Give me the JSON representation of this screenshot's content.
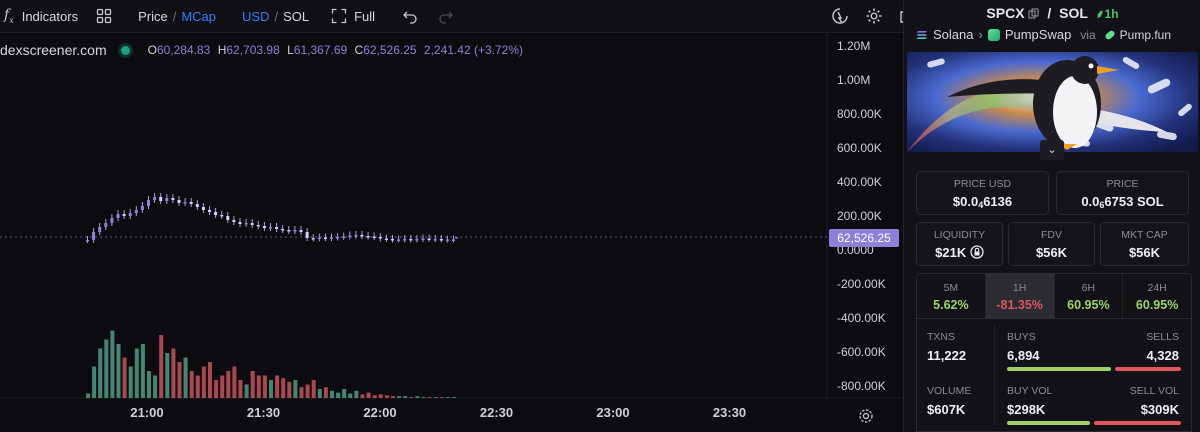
{
  "toolbar": {
    "indicators": "Indicators",
    "price": "Price",
    "mcap": "MCap",
    "usd": "USD",
    "sol": "SOL",
    "full": "Full"
  },
  "legend": {
    "source": "dexscreener.com",
    "o_key": "O",
    "o_val": "60,284.83",
    "h_key": "H",
    "h_val": "62,703.98",
    "l_key": "L",
    "l_val": "61,367.69",
    "c_key": "C",
    "c_val": "62,526.25",
    "change": "2,241.42 (+3.72%)"
  },
  "current_price_label": "62,526.25",
  "colors": {
    "up": "#4c9e83",
    "down": "#c8545a",
    "line": "#a99ee6",
    "accent": "#2f80ff",
    "green": "#4ec16e",
    "red": "#e0565a"
  },
  "chart_data": {
    "type": "candlestick",
    "y_axis_ticks": [
      "1.20M",
      "1.00M",
      "800.00K",
      "600.00K",
      "400.00K",
      "200.00K",
      "0.0000",
      "-200.00K",
      "-400.00K",
      "-600.00K",
      "-800.00K"
    ],
    "x_axis_ticks": [
      "21:00",
      "21:30",
      "22:00",
      "22:30",
      "23:00",
      "23:30"
    ],
    "ylim": [
      -900000,
      1250000
    ],
    "last_price": 62526.25,
    "price": [
      0,
      80,
      130,
      170,
      220,
      260,
      240,
      270,
      300,
      340,
      400,
      430,
      390,
      420,
      400,
      370,
      380,
      360,
      330,
      300,
      280,
      250,
      240,
      200,
      180,
      160,
      170,
      150,
      140,
      120,
      130,
      110,
      100,
      90,
      100,
      80,
      20,
      15,
      25,
      20,
      25,
      30,
      35,
      45,
      50,
      40,
      35,
      30,
      15,
      10,
      5,
      5,
      10,
      5,
      10,
      15,
      10,
      10,
      5,
      5,
      5
    ],
    "volume": [
      0.05,
      0.35,
      0.55,
      0.65,
      0.75,
      0.6,
      0.45,
      0.35,
      0.55,
      0.6,
      0.3,
      0.25,
      0.7,
      0.5,
      0.55,
      0.4,
      0.45,
      0.3,
      0.25,
      0.35,
      0.4,
      0.2,
      0.25,
      0.3,
      0.35,
      0.2,
      0.15,
      0.3,
      0.25,
      0.25,
      0.2,
      0.25,
      0.22,
      0.18,
      0.2,
      0.12,
      0.15,
      0.2,
      0.1,
      0.12,
      0.08,
      0.06,
      0.1,
      0.05,
      0.08,
      0.04,
      0.06,
      0.03,
      0.04,
      0.03,
      0.02,
      0.02,
      0.02,
      0.01,
      0.02,
      0.01,
      0.01,
      0.01,
      0.01,
      0.01,
      0.01
    ]
  },
  "panel": {
    "symbol": "SPCX",
    "quote": "SOL",
    "timeframe": "1h",
    "chain": "Solana",
    "dex": "PumpSwap",
    "via": "via",
    "launchpad": "Pump.fun",
    "price_usd_label": "PRICE USD",
    "price_usd_a": "$0.0",
    "price_usd_sub": "4",
    "price_usd_b": "6136",
    "price_label": "PRICE",
    "price_sol_a": "0.0",
    "price_sol_sub": "6",
    "price_sol_b": "6753 SOL",
    "liquidity_label": "LIQUIDITY",
    "liquidity": "$21K",
    "fdv_label": "FDV",
    "fdv": "$56K",
    "mcap_label": "MKT CAP",
    "mcap": "$56K",
    "timeframes": [
      {
        "label": "5M",
        "value": "5.62%",
        "dir": "up"
      },
      {
        "label": "1H",
        "value": "-81.35%",
        "dir": "down"
      },
      {
        "label": "6H",
        "value": "60.95%",
        "dir": "up"
      },
      {
        "label": "24H",
        "value": "60.95%",
        "dir": "up"
      }
    ],
    "txns_label": "TXNS",
    "txns": "11,222",
    "buys_label": "BUYS",
    "buys": "6,894",
    "sells_label": "SELLS",
    "sells": "4,328",
    "volume_label": "VOLUME",
    "volume": "$607K",
    "buy_vol_label": "BUY VOL",
    "buy_vol": "$298K",
    "sell_vol_label": "SELL VOL",
    "sell_vol": "$309K",
    "buys_ratio": 0.614,
    "buy_vol_ratio": 0.491
  }
}
